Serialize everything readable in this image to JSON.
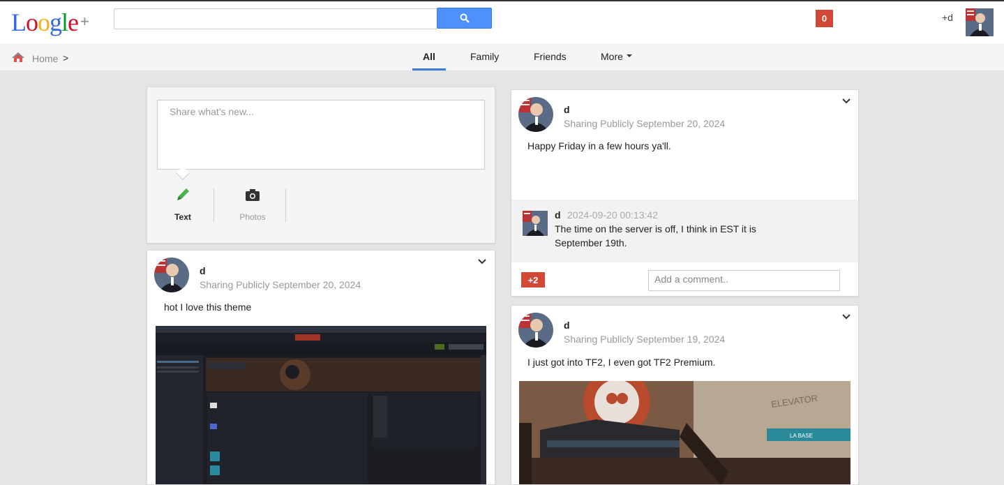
{
  "header": {
    "logo_letters": [
      "L",
      "o",
      "o",
      "g",
      "l",
      "e"
    ],
    "logo_plus": "+",
    "search_placeholder": "",
    "notification_count": "0",
    "user_label": "+d"
  },
  "nav": {
    "home_label": "Home",
    "crumb_separator": ">",
    "tabs": [
      {
        "label": "All",
        "active": true
      },
      {
        "label": "Family",
        "active": false
      },
      {
        "label": "Friends",
        "active": false
      },
      {
        "label": "More",
        "active": false
      }
    ]
  },
  "share": {
    "placeholder": "Share what's new...",
    "options": [
      {
        "label": "Text",
        "icon": "pencil-icon",
        "active": true
      },
      {
        "label": "Photos",
        "icon": "camera-icon",
        "active": false
      }
    ]
  },
  "posts": [
    {
      "author": "d",
      "visibility": "Sharing Publicly",
      "date": "September 20, 2024",
      "text": "hot I love this theme",
      "image": "steam-library-screenshot"
    },
    {
      "author": "d",
      "visibility": "Sharing Publicly",
      "date": "September 20, 2024",
      "text": "Happy Friday in a few hours ya'll.",
      "comment": {
        "author": "d",
        "timestamp": "2024-09-20 00:13:42",
        "text_line1": "The time on the server is off, I think in EST it is",
        "text_line2": "September 19th."
      },
      "plus_count": "+2",
      "comment_placeholder": "Add a comment.."
    },
    {
      "author": "d",
      "visibility": "Sharing Publicly",
      "date": "September 19, 2024",
      "text": "I just got into TF2, I even got TF2 Premium.",
      "image": "tf2-map-screenshot",
      "image_text": [
        "ELEVATOR",
        "LA BASE"
      ]
    }
  ],
  "colors": {
    "accent_blue": "#4d90fe",
    "notif_red": "#d14836",
    "tab_underline": "#3a7bd5"
  }
}
